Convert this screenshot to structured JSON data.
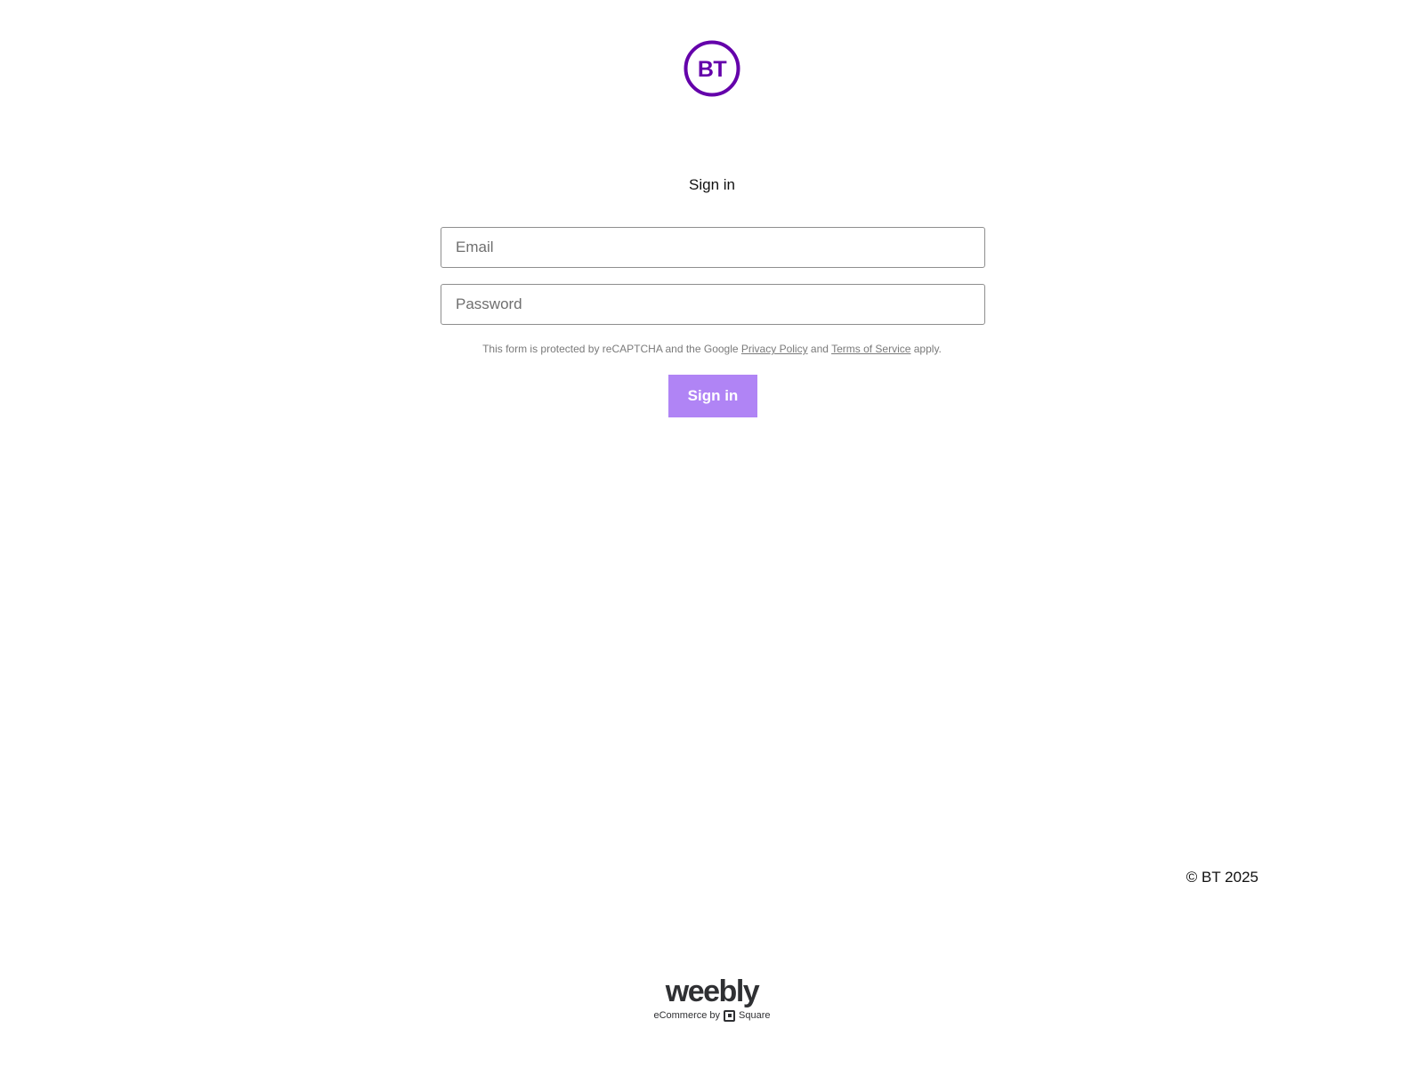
{
  "brand": {
    "logo_text": "BT",
    "color": "#6400aa"
  },
  "form": {
    "title": "Sign in",
    "email_placeholder": "Email",
    "password_placeholder": "Password",
    "recaptcha_prefix": "This form is protected by reCAPTCHA and the Google ",
    "privacy_link": "Privacy Policy",
    "recaptcha_and": " and ",
    "terms_link": "Terms of Service",
    "recaptcha_suffix": " apply.",
    "submit_label": "Sign in",
    "submit_color": "#b084f5"
  },
  "footer": {
    "copyright": "© BT 2025",
    "weebly_word": "weebly",
    "weebly_by": "eCommerce by",
    "square_label": "Square"
  },
  "icons": {
    "logo": "bt-logo-icon",
    "square": "square-logo-icon"
  }
}
